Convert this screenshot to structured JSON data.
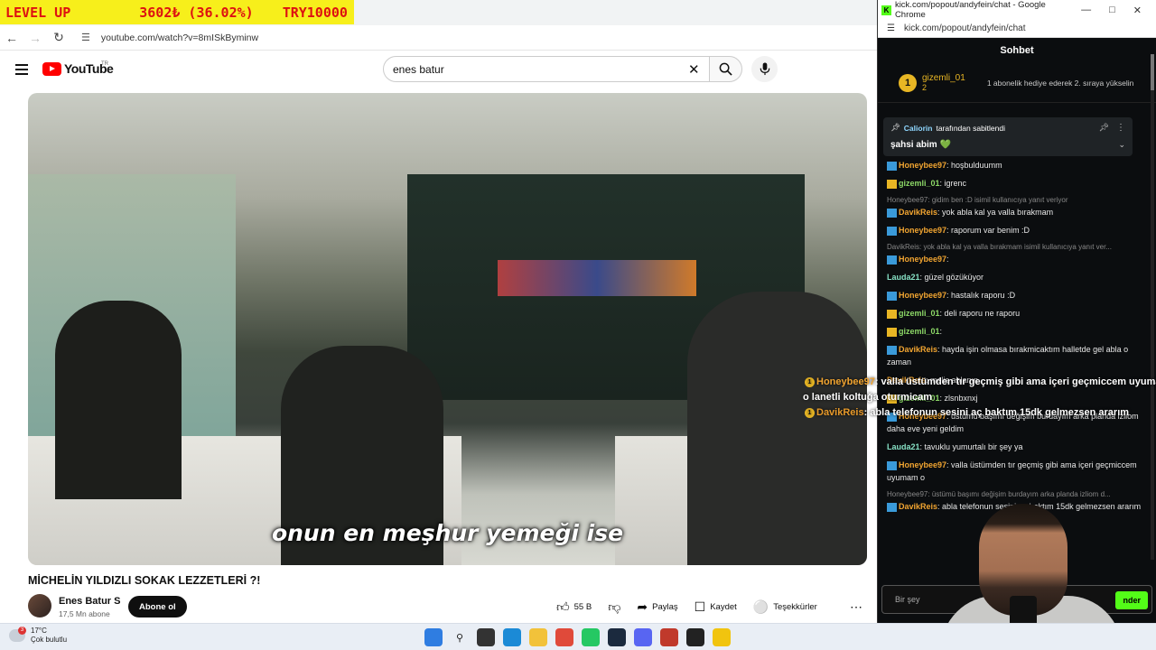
{
  "overlay": {
    "left": "LEVEL UP",
    "center": "3602₺ (36.02%)",
    "right": "TRY10000"
  },
  "browser": {
    "url": "youtube.com/watch?v=8mISkByminw"
  },
  "youtube": {
    "logo": "YouTube",
    "region": "TR",
    "search_value": "enes batur",
    "subtitle": "onun en meşhur yemeği ise",
    "title": "MİCHELİN YILDIZLI SOKAK LEZZETLERİ ?!",
    "channel": "Enes Batur S",
    "subscribers": "17,5 Mn abone",
    "subscribe": "Abone ol",
    "likes": "55 B",
    "share": "Paylaş",
    "save": "Kaydet",
    "thanks": "Teşekkürler"
  },
  "video_overlay_chat": [
    {
      "name": "Honeybee97",
      "text": ": valla üstümden tır geçmiş gibi ama içeri geçmiccem uyumam"
    },
    {
      "name": "",
      "text": "o lanetli koltuğa oturmicam"
    },
    {
      "name": "DavikReis",
      "text": ": abla telefonun sesini aç baktım 15dk gelmezsen ararım"
    }
  ],
  "popup": {
    "window_title": "kick.com/popout/andyfein/chat - Google Chrome",
    "url": "kick.com/popout/andyfein/chat",
    "header": "Sohbet",
    "top_gifter": {
      "rank": "1",
      "name": "gizemli_01",
      "count": "2",
      "hint": "1 abonelik hediye ederek 2. sıraya yükselin"
    },
    "pinned_by": "Caliorin",
    "pinned_by_suffix": "tarafından sabitlendi",
    "pinned_msg": "şahsi abim 💚",
    "input_placeholder": "Bir şey",
    "input_placeholder2": "gönder",
    "send": "nder",
    "messages": [
      {
        "reply": "",
        "badges": "b",
        "name": "Honeybee97",
        "text": ": hoşbulduumm",
        "c": ""
      },
      {
        "reply": "",
        "badges": "g",
        "name": "gizemli_01",
        "text": ": igrenc",
        "c": "grn"
      },
      {
        "reply": "Honeybee97: gidim ben :D isimil kullanıcıya yanıt veriyor",
        "badges": "b",
        "name": "DavikReis",
        "text": ": yok abla kal ya valla bırakmam",
        "c": ""
      },
      {
        "reply": "",
        "badges": "b",
        "name": "Honeybee97",
        "text": ": raporum var benim :D",
        "c": ""
      },
      {
        "reply": "DavikReis: yok abla kal ya valla bırakmam isimil kullanıcıya yanıt ver...",
        "badges": "b",
        "name": "Honeybee97",
        "text": ":",
        "c": ""
      },
      {
        "reply": "",
        "badges": "",
        "name": "Lauda21",
        "text": ": güzel gözüküyor",
        "c": "teal"
      },
      {
        "reply": "",
        "badges": "b",
        "name": "Honeybee97",
        "text": ": hastalık raporu :D",
        "c": ""
      },
      {
        "reply": "",
        "badges": "g",
        "name": "gizemli_01",
        "text": ": deli raporu ne raporu",
        "c": "grn"
      },
      {
        "reply": "",
        "badges": "g",
        "name": "gizemli_01",
        "text": ":",
        "c": "grn"
      },
      {
        "reply": "",
        "badges": "b",
        "name": "DavikReis",
        "text": ": hayda işin olmasa bırakmicaktım halletde gel abla o zaman",
        "c": ""
      },
      {
        "reply": "",
        "badges": "",
        "name": "DavikReis",
        "text": ": melis ablanın",
        "c": ""
      },
      {
        "reply": "",
        "badges": "g",
        "name": "gizemli_01",
        "text": ": zlsnbxnxj",
        "c": "grn"
      },
      {
        "reply": "",
        "badges": "b",
        "name": "Honeybee97",
        "text": ": üstümü başımı değişim burdayım arka planda izliom daha eve yeni geldim",
        "c": ""
      },
      {
        "reply": "",
        "badges": "",
        "name": "Lauda21",
        "text": ": tavuklu yumurtalı bir şey ya",
        "c": "teal"
      },
      {
        "reply": "",
        "badges": "b",
        "name": "Honeybee97",
        "text": ": valla üstümden tır geçmiş gibi ama içeri geçmiccem uyumam o",
        "c": ""
      },
      {
        "reply": "Honeybee97: üstümü başımı değişim burdayım arka planda izliom d...",
        "badges": "b",
        "name": "DavikReis",
        "text": ": abla telefonun sesini aç baktım 15dk gelmezsen ararım",
        "c": ""
      }
    ]
  },
  "taskbar": {
    "temp": "17°C",
    "weather": "Çok bulutlu",
    "badge": "3"
  }
}
